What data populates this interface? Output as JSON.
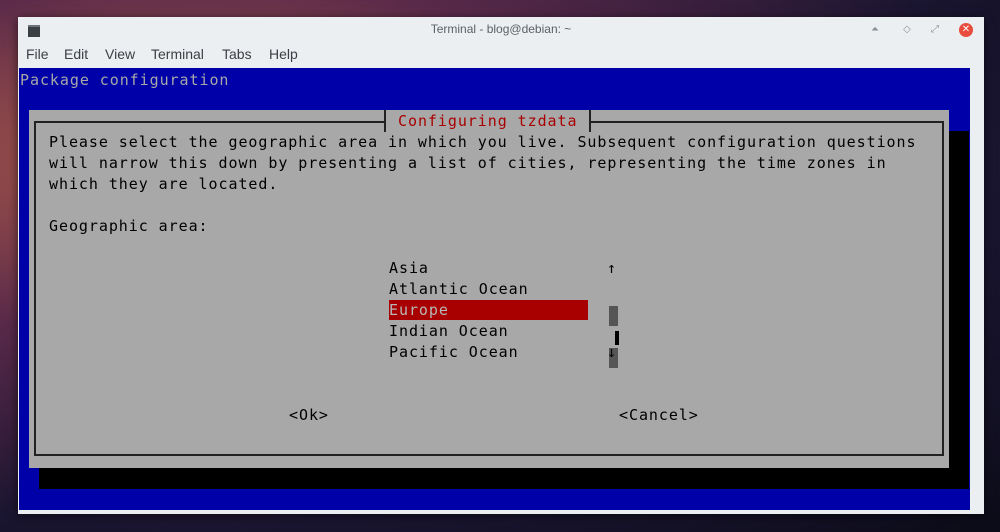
{
  "window": {
    "title": "Terminal - blog@debian: ~",
    "buttons": {
      "minimize": "⏶",
      "maximize": "◇",
      "restore": "⤢",
      "close": "✕"
    }
  },
  "menu": {
    "file": "File",
    "edit": "Edit",
    "view": "View",
    "terminal": "Terminal",
    "tabs": "Tabs",
    "help": "Help"
  },
  "terminal": {
    "header": "Package configuration",
    "dialog": {
      "title": "Configuring tzdata",
      "description": [
        "Please select the geographic area in which you live. Subsequent configuration questions",
        "will narrow this down by presenting a list of cities, representing the time zones in",
        "which they are located."
      ],
      "prompt": "Geographic area:",
      "options": [
        "Asia",
        "Atlantic Ocean",
        "Europe",
        "Indian Ocean",
        "Pacific Ocean"
      ],
      "selected": "Europe",
      "scroll_up": "↑",
      "scroll_down": "↓",
      "ok_button": "<Ok>",
      "cancel_button": "<Cancel>"
    }
  },
  "colors": {
    "terminal_bg": "#0000a8",
    "dialog_bg": "#a8a8a8",
    "selection": "#a80000",
    "title_color": "#a80000"
  }
}
